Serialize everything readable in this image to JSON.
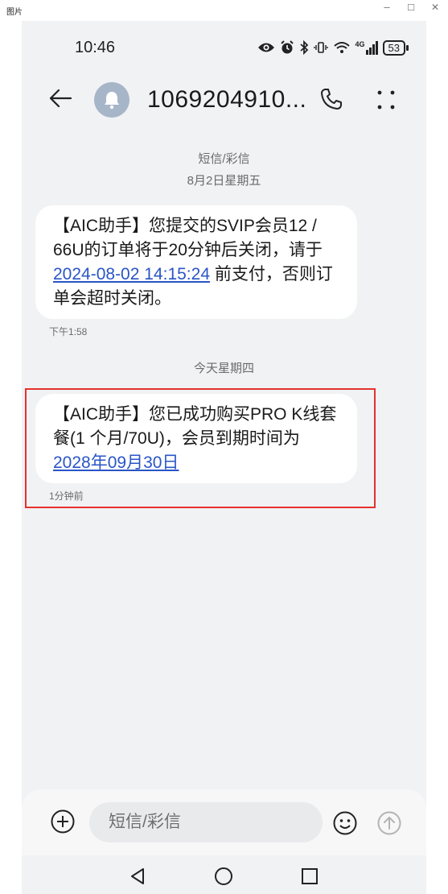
{
  "window": {
    "title": "图片",
    "minimize": "–",
    "maximize": "☐",
    "close": "✕"
  },
  "status_bar": {
    "time": "10:46",
    "signal": "4G",
    "battery": "53"
  },
  "header": {
    "contact": "1069204910..."
  },
  "thread": {
    "type_label": "短信/彩信",
    "date_label_1": "8月2日星期五",
    "message_1": {
      "text_before": "【AIC助手】您提交的SVIP会员12 / 66U的订单将于20分钟后关闭，请于",
      "link": "2024-08-02 14:15:24",
      "text_after": "前支付，否则订单会超时关闭。",
      "time": "下午1:58"
    },
    "date_label_2": "今天星期四",
    "message_2": {
      "text_before": "【AIC助手】您已成功购买PRO K线套餐(1 个月/70U)，会员到期时间为",
      "link": "2028年09月30日",
      "time": "1分钟前"
    }
  },
  "composer": {
    "placeholder": "短信/彩信"
  },
  "colors": {
    "link": "#2a55c7",
    "highlight": "#e5322d",
    "background": "#f1f2f4",
    "bubble": "#ffffff"
  }
}
